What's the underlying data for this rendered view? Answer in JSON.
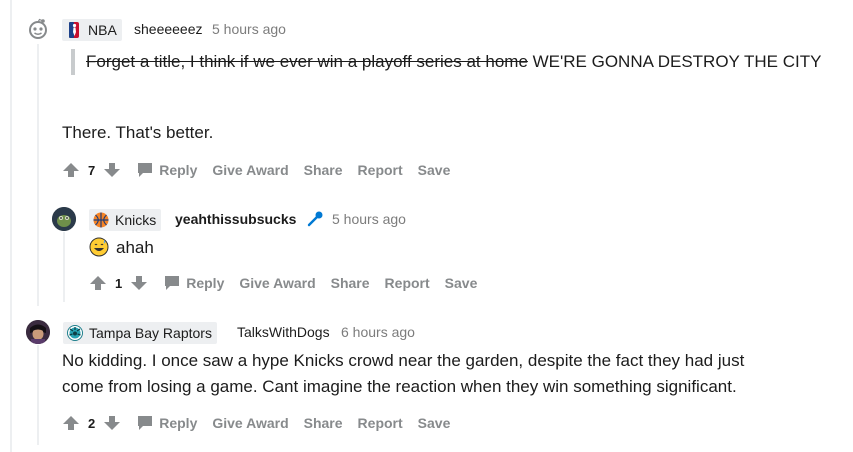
{
  "comments": [
    {
      "flair": "NBA",
      "flair_icon": "nba-logo-icon",
      "username": "sheeeeeez",
      "time": "5 hours ago",
      "quote_struck": "Forget a title, I think if we ever win a playoff series at home",
      "quote_rest": " WE'RE GONNA DESTROY THE CITY",
      "body": "There. That's better.",
      "score": "7"
    },
    {
      "flair": "Knicks",
      "flair_icon": "knicks-logo-icon",
      "username": "yeahthissubsucks",
      "time": "5 hours ago",
      "body_emoji": "grinning-sweat-emoji",
      "body": "ahah",
      "score": "1"
    },
    {
      "flair": "Tampa Bay Raptors",
      "flair_icon": "raptors-logo-icon",
      "username": "TalksWithDogs",
      "time": "6 hours ago",
      "body_line1": "No kidding. I once saw a hype Knicks crowd near the garden, despite the fact they had just",
      "body_line2": "come from losing a game. Cant imagine the reaction when they win something significant.",
      "score": "2"
    }
  ],
  "actions": {
    "reply": "Reply",
    "give_award": "Give Award",
    "share": "Share",
    "report": "Report",
    "save": "Save"
  },
  "colors": {
    "meta_gray": "#7c7c7c",
    "action_gray": "#878a8c",
    "flair_bg": "#edeff1",
    "thread_line": "#edeff1",
    "quote_bar": "#c8cbcd",
    "mod_blue": "#0079d3"
  }
}
